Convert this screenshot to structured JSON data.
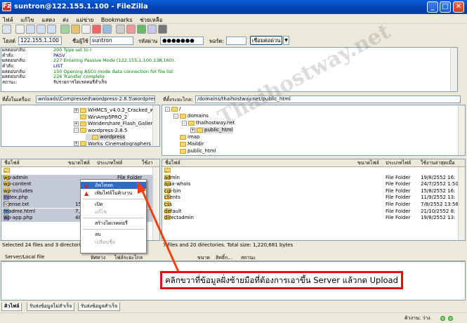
{
  "window": {
    "title": "suntron@122.155.1.100 - FileZilla",
    "app_icon": "Fz"
  },
  "menu": [
    "ไฟล์",
    "แก้ไข",
    "แสดง",
    "ส่ง",
    "แม่ข่าย",
    "Bookmarks",
    "ช่วยเหลือ"
  ],
  "connect": {
    "host_label": "โฮสต์",
    "host_value": "122.155.1.100",
    "user_label": "ชื่อผู้ใช้",
    "user_value": "suntron",
    "pass_label": "รหัสผ่าน",
    "pass_value": "●●●●●●●",
    "port_label": "พอร์ต:",
    "port_value": "",
    "button": "เชื่อมต่อด่วน"
  },
  "log": [
    {
      "k": "ผลตอบกลับ:",
      "v": "200 Type set to I",
      "c": "#008000"
    },
    {
      "k": "คำสั่ง:",
      "v": "PASV",
      "c": "#000080"
    },
    {
      "k": "ผลตอบกลับ:",
      "v": "227 Entering Passive Mode (122,155,1,100,138,160).",
      "c": "#008000"
    },
    {
      "k": "คำสั่ง:",
      "v": "LIST",
      "c": "#000080"
    },
    {
      "k": "ผลตอบกลับ:",
      "v": "150 Opening ASCII mode data connection for file list",
      "c": "#008000"
    },
    {
      "k": "ผลตอบกลับ:",
      "v": "226 Transfer complete",
      "c": "#008000"
    },
    {
      "k": "สถานะ:",
      "v": "รับรายการไดเรคทอรีสำเร็จ",
      "c": "#000000"
    }
  ],
  "local": {
    "path_label": "ที่ตั้งในเครื่อง:",
    "path": "wnloads\\Compressed\\wordpress-2.8.5\\wordpress\\",
    "tree": [
      {
        "label": "WHMCS_v4.0.2_Cracked_w",
        "exp": "+"
      },
      {
        "label": "WinAmp5PRO_2",
        "exp": ""
      },
      {
        "label": "Wondershare_Flash_Gallery",
        "exp": "+"
      },
      {
        "label": "wordpress-2.8.5",
        "exp": "-"
      },
      {
        "label": "wordpress",
        "exp": "",
        "sel": true
      },
      {
        "label": "Works_Cinematographers",
        "exp": "+"
      }
    ],
    "headers": [
      "ชื่อไฟล์",
      "ขนาดไฟล์",
      "ประเภทไฟล์",
      "ใช้งา"
    ],
    "files": [
      {
        "name": "..",
        "size": "",
        "type": "",
        "icon": "folder"
      },
      {
        "name": "wp-admin",
        "size": "",
        "type": "File Folder",
        "icon": "folder",
        "sel": true
      },
      {
        "name": "wp-content",
        "size": "",
        "type": "",
        "icon": "folder",
        "sel": true
      },
      {
        "name": "wp-includes",
        "size": "",
        "type": "",
        "icon": "folder",
        "sel": true
      },
      {
        "name": "index.php",
        "size": "",
        "type": "",
        "icon": "php",
        "sel": true
      },
      {
        "name": "license.txt",
        "size": "15,4",
        "type": "",
        "icon": "txt",
        "sel": true
      },
      {
        "name": "readme.html",
        "size": "7,1",
        "type": "",
        "icon": "html",
        "sel": true
      },
      {
        "name": "wp-app.php",
        "size": "40,1",
        "type": "",
        "icon": "php",
        "sel": true
      }
    ],
    "status": "Selected 24 files and 3 directories. To"
  },
  "remote": {
    "path_label": "ที่ตั้งระยะไกล:",
    "path": "/domains/thaihostway.net/public_html",
    "tree": [
      {
        "label": "/",
        "exp": "-",
        "indent": 0
      },
      {
        "label": "domains",
        "exp": "-",
        "indent": 1
      },
      {
        "label": "thaihostway.net",
        "exp": "-",
        "indent": 2
      },
      {
        "label": "public_html",
        "exp": "+",
        "indent": 3,
        "sel": true
      },
      {
        "label": "imap",
        "exp": "",
        "indent": 1
      },
      {
        "label": "Maildir",
        "exp": "",
        "indent": 1
      },
      {
        "label": "public_html",
        "exp": "",
        "indent": 1
      }
    ],
    "headers": [
      "ชื่อไฟล์",
      "ขนาดไฟล์",
      "ประเภทไฟล์",
      "ใช้งานล่าสุดเมื่อ"
    ],
    "files": [
      {
        "name": "..",
        "type": "",
        "date": ""
      },
      {
        "name": "admin",
        "type": "File Folder",
        "date": "19/8/2552 16:"
      },
      {
        "name": "ajax-whois",
        "type": "File Folder",
        "date": "24/7/2552 1:50"
      },
      {
        "name": "cgi-bin",
        "type": "File Folder",
        "date": "15/8/2552 16:"
      },
      {
        "name": "clients",
        "type": "File Folder",
        "date": "11/9/2552 13:"
      },
      {
        "name": "css",
        "type": "File Folder",
        "date": "7/8/2552 13:56"
      },
      {
        "name": "default",
        "type": "File Folder",
        "date": "21/10/2552 8:"
      },
      {
        "name": "directadmin",
        "type": "File Folder",
        "date": "19/8/2552 13:"
      }
    ],
    "status": "7 files and 20 directories. Total size: 1,220,681 bytes"
  },
  "context_menu": {
    "items": [
      {
        "label": "อัพโหลด",
        "state": "highlight",
        "icon": "upload"
      },
      {
        "label": "เพิ่มไฟล์ในคิวงาน",
        "state": "normal",
        "icon": "queue"
      },
      {
        "sep": true
      },
      {
        "label": "เปิด",
        "state": "normal"
      },
      {
        "label": "แก้ไข",
        "state": "disabled"
      },
      {
        "sep": true
      },
      {
        "label": "สร้างไดเรคทอรี",
        "state": "normal"
      },
      {
        "sep": true
      },
      {
        "label": "ลบ",
        "state": "normal"
      },
      {
        "label": "เปลี่ยนชื่อ",
        "state": "disabled"
      }
    ]
  },
  "queue": {
    "headers": [
      "Server/Local file",
      "ทิศทาง",
      "ไฟล์ระยะไกล",
      "ขนาด",
      "สิทธิ์ก...",
      "สถานะ"
    ]
  },
  "tabs": [
    "คิวไฟล์",
    "รับส่งข้อมูลไม่สำเร็จ",
    "รับส่งข้อมูลสำเร็จ"
  ],
  "bottom_status": "คิวงาน: ว่าง",
  "callout": "คลิกขวาที่ข้อมูลฝั่งซ้ายมือที่ต้องการเอาขึ้น Server แล้วกด Upload",
  "watermark": "Thaihostway.net",
  "colors": {
    "accent": "#316ac5",
    "callout_border": "#e31010",
    "arrow": "#f04010"
  }
}
